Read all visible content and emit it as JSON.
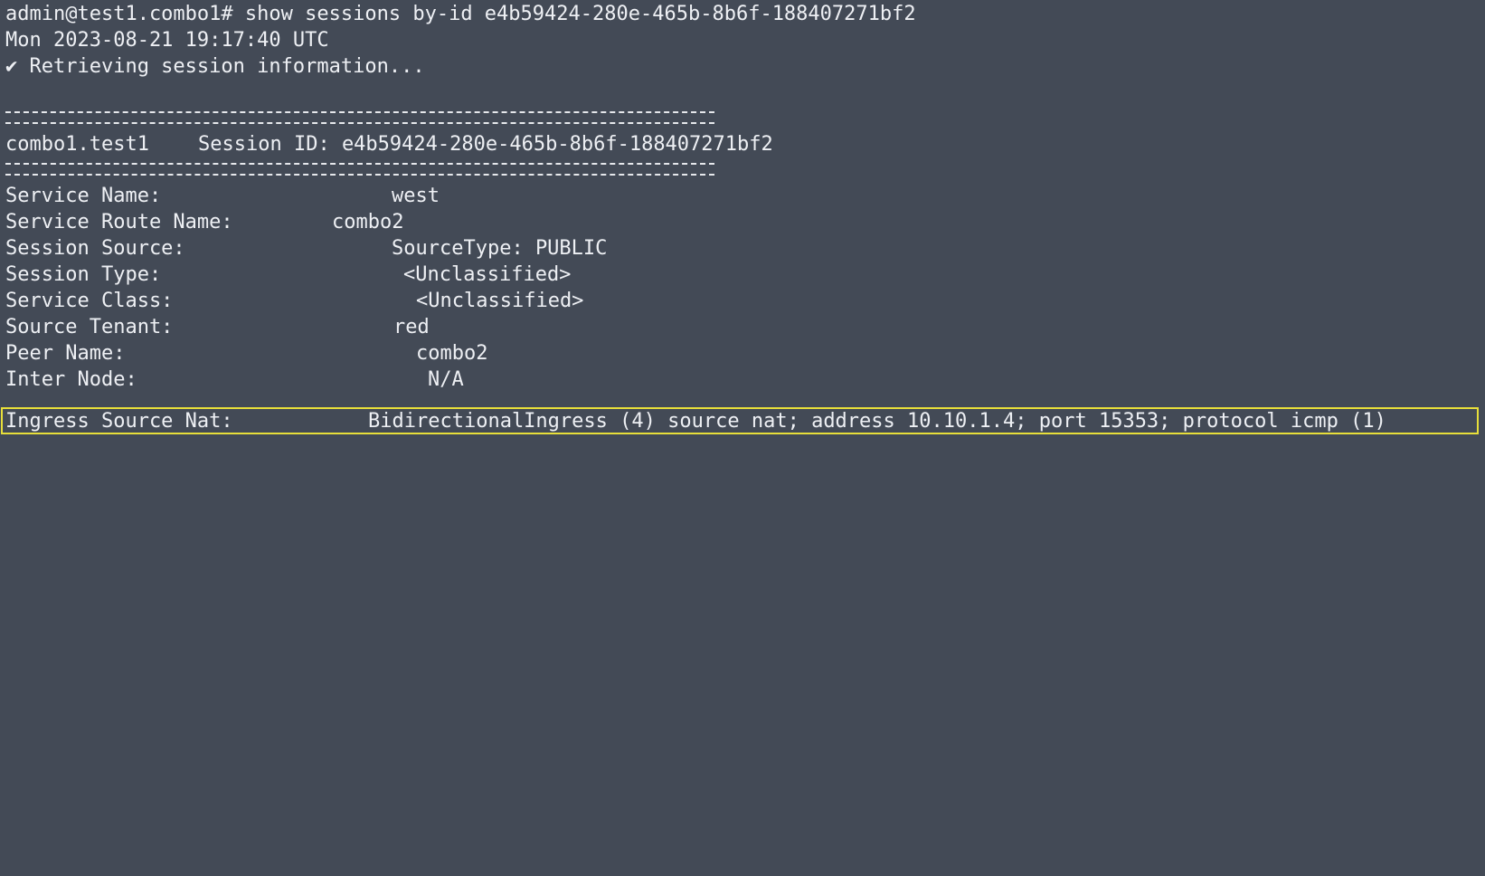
{
  "terminal": {
    "prompt": "admin@test1.combo1# ",
    "command": "show sessions by-id e4b59424-280e-465b-8b6f-188407271bf2",
    "timestamp": "Mon 2023-08-21 19:17:40 UTC",
    "status_icon": "check-icon",
    "status_text": "✔ Retrieving session information..."
  },
  "session": {
    "node": "combo1.test1",
    "id_label": "Session ID: e4b59424-280e-465b-8b6f-188407271bf2",
    "fields": [
      {
        "label": "Service Name:",
        "value": "west"
      },
      {
        "label": "Service Route Name:",
        "value": "combo2"
      },
      {
        "label": "Session Source:",
        "value": "SourceType: PUBLIC"
      },
      {
        "label": "Session Type:",
        "value": "<Unclassified>"
      },
      {
        "label": "Service Class:",
        "value": "<Unclassified>"
      },
      {
        "label": "Source Tenant:",
        "value": "red"
      },
      {
        "label": "Peer Name:",
        "value": "combo2"
      },
      {
        "label": "Inter Node:",
        "value": "N/A"
      },
      {
        "label": "Ingress Source Nat:",
        "value": "BidirectionalIngress (4) source nat; address 10.10.1.4; port 15353; protocol icmp (1)"
      }
    ]
  },
  "colors": {
    "background": "#434a56",
    "text": "#eef0f4",
    "highlight": "#e8df3a"
  }
}
